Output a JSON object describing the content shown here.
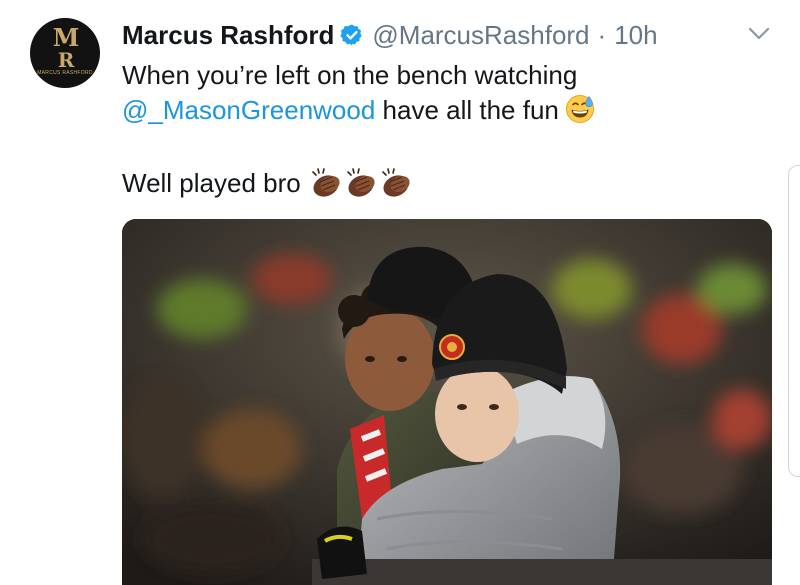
{
  "tweet": {
    "author_name": "Marcus Rashford",
    "handle": "@MarcusRashford",
    "separator": "·",
    "time": "10h",
    "line1": "When you’re left on the bench watching",
    "mention": "@_MasonGreenwood",
    "line2_rest": " have all the fun",
    "line3": "Well played bro",
    "emoji_after_line2": "grinning-face-with-sweat",
    "emoji_after_line3": [
      "clapping-hands",
      "clapping-hands",
      "clapping-hands"
    ]
  },
  "avatar": {
    "monogram_top": "M",
    "monogram_bottom": "R",
    "wordmark": "MARCUS RASHFORD"
  },
  "colors": {
    "link": "#1b95e0",
    "verified": "#1da1f2",
    "secondary_text": "#657786",
    "avatar_gold": "#c9a96a"
  },
  "media": {
    "description_icon": "photo-two-kids-in-stand",
    "badge": "club-crest"
  }
}
